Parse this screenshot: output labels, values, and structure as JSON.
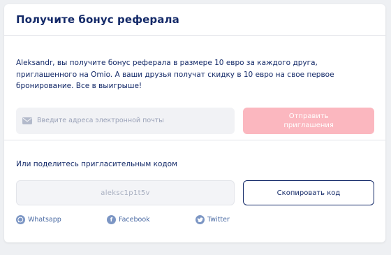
{
  "header": {
    "title": "Получите бонус реферала"
  },
  "invite": {
    "description": "Aleksandr, вы получите бонус реферала в размере 10 евро за каждого друга, приглашенного на Omio. А ваши друзья получат скидку в 10 евро на свое первое бронирование. Все в выигрыше!",
    "email_placeholder": "Введите адреса электронной почты",
    "email_icon": "mail-icon",
    "send_button": "Отправить приглашения",
    "send_button_color": "#fbb7bf"
  },
  "share": {
    "label": "Или поделитесь пригласительным кодом",
    "code": "aleksc1p1t5v",
    "copy_button": "Скопировать код",
    "social": [
      {
        "label": "Whatsapp",
        "icon": "whatsapp-icon"
      },
      {
        "label": "Facebook",
        "icon": "facebook-icon"
      },
      {
        "label": "Twitter",
        "icon": "twitter-icon"
      }
    ]
  },
  "colors": {
    "text_primary": "#132968",
    "link": "#4a6aa3",
    "accent_disabled": "#fbb7bf"
  }
}
